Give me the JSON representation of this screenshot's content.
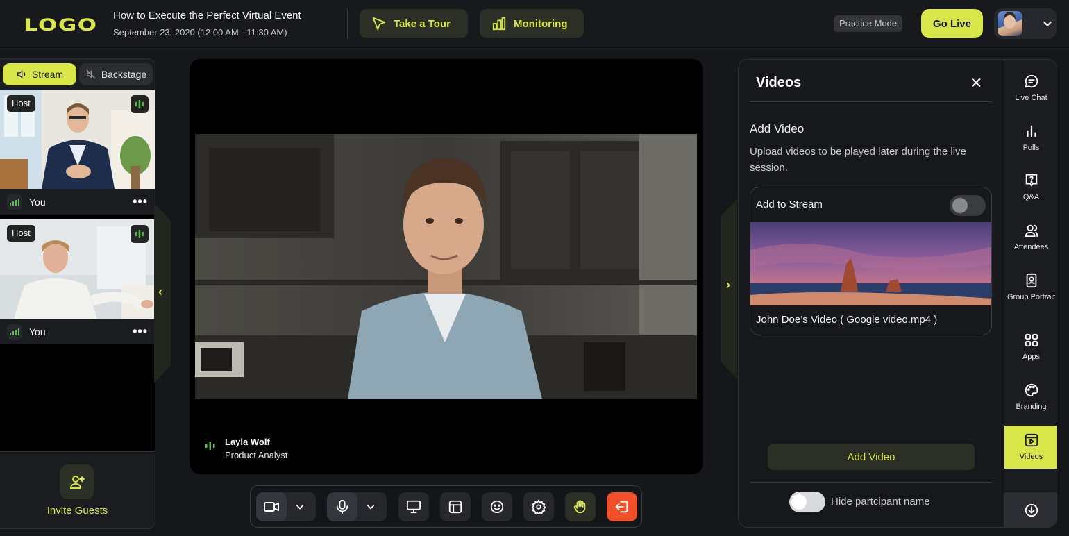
{
  "header": {
    "logo": "LOGO",
    "event_title": "How to Execute the Perfect Virtual Event",
    "event_date": "September 23, 2020 (12:00 AM - 11:30 AM)",
    "tour_label": "Take a Tour",
    "monitoring_label": "Monitoring",
    "practice_mode": "Practice Mode",
    "go_live": "Go Live"
  },
  "left_panel": {
    "tabs": [
      {
        "label": "Stream",
        "active": true
      },
      {
        "label": "Backstage",
        "active": false
      }
    ],
    "participants": [
      {
        "badge": "Host",
        "name": "You"
      },
      {
        "badge": "Host",
        "name": "You"
      }
    ],
    "more_glyph": "•••",
    "invite_label": "Invite Guests"
  },
  "stage": {
    "speaker_name": "Layla Wolf",
    "speaker_role": "Product Analyst"
  },
  "controls": [
    {
      "name": "camera",
      "icon": "video-camera-icon"
    },
    {
      "name": "microphone",
      "icon": "microphone-icon"
    },
    {
      "name": "screen-share",
      "icon": "monitor-icon"
    },
    {
      "name": "layout",
      "icon": "layout-icon"
    },
    {
      "name": "reactions",
      "icon": "smile-icon"
    },
    {
      "name": "settings",
      "icon": "gear-icon"
    },
    {
      "name": "raise-hand",
      "icon": "hand-icon"
    },
    {
      "name": "leave",
      "icon": "exit-icon"
    }
  ],
  "videos_panel": {
    "title": "Videos",
    "close_glyph": "✕",
    "heading": "Add Video",
    "description": "Upload videos to be played later during the live session.",
    "add_to_stream": "Add to Stream",
    "add_to_stream_on": false,
    "video_filename": "John Doe’s Video ( Google video.mp4 )",
    "add_button": "Add Video",
    "hide_participant_label": "Hide partcipant name",
    "hide_participant_on": false
  },
  "sidebar_nav": [
    {
      "label": "Live Chat",
      "icon": "chat-icon"
    },
    {
      "label": "Polls",
      "icon": "poll-icon"
    },
    {
      "label": "Q&A",
      "icon": "question-icon"
    },
    {
      "label": "Attendees",
      "icon": "attendees-icon"
    },
    {
      "label": "Group Portrait",
      "icon": "portrait-icon"
    },
    {
      "label": "Apps",
      "icon": "apps-icon"
    },
    {
      "label": "Branding",
      "icon": "palette-icon"
    },
    {
      "label": "Videos",
      "icon": "video-play-icon",
      "active": true
    }
  ],
  "colors": {
    "accent": "#d9e64a",
    "background": "#16171b",
    "leave_button": "#f0502a",
    "audio_green": "#5bbd4e"
  }
}
